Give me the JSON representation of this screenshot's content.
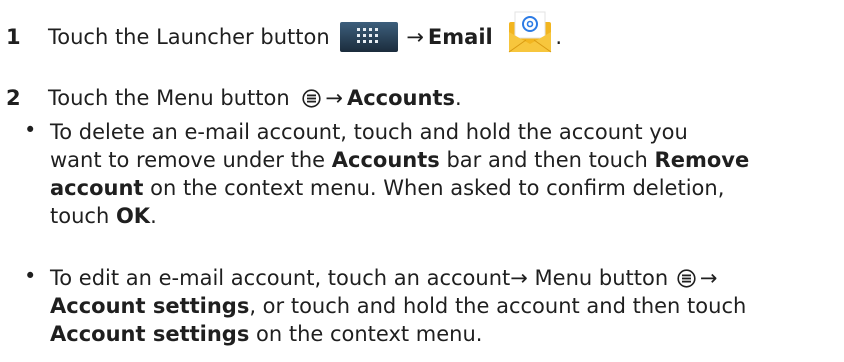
{
  "step1": {
    "number": "1",
    "text": "Touch the Launcher button",
    "arrow": "→",
    "email": "Email",
    "end": "."
  },
  "step2": {
    "number": "2",
    "text": "Touch the Menu button",
    "arrow": "→",
    "accounts": "Accounts",
    "end": "."
  },
  "bullet1": {
    "dot": "•",
    "l1": "To delete an e-mail account, touch and hold the account you",
    "l2a": "want to remove under the ",
    "l2b": "Accounts",
    "l2c": " bar and then touch ",
    "l2d": "Remove",
    "l3a": "account",
    "l3b": " on the context menu. When asked to confirm deletion,",
    "l4a": "touch ",
    "l4b": "OK",
    "l4c": "."
  },
  "bullet2": {
    "dot": "•",
    "l1a": "To edit an e-mail account, touch an account",
    "l1b": "→",
    "l1c": " Menu button ",
    "l1d": "→",
    "l2a": "Account settings",
    "l2b": ", or touch and hold the account and then touch",
    "l3a": "Account settings",
    "l3b": " on the context menu."
  },
  "icons": {
    "launcher": "launcher-grid-icon",
    "email": "email-envelope-icon",
    "menu": "menu-circle-icon"
  }
}
